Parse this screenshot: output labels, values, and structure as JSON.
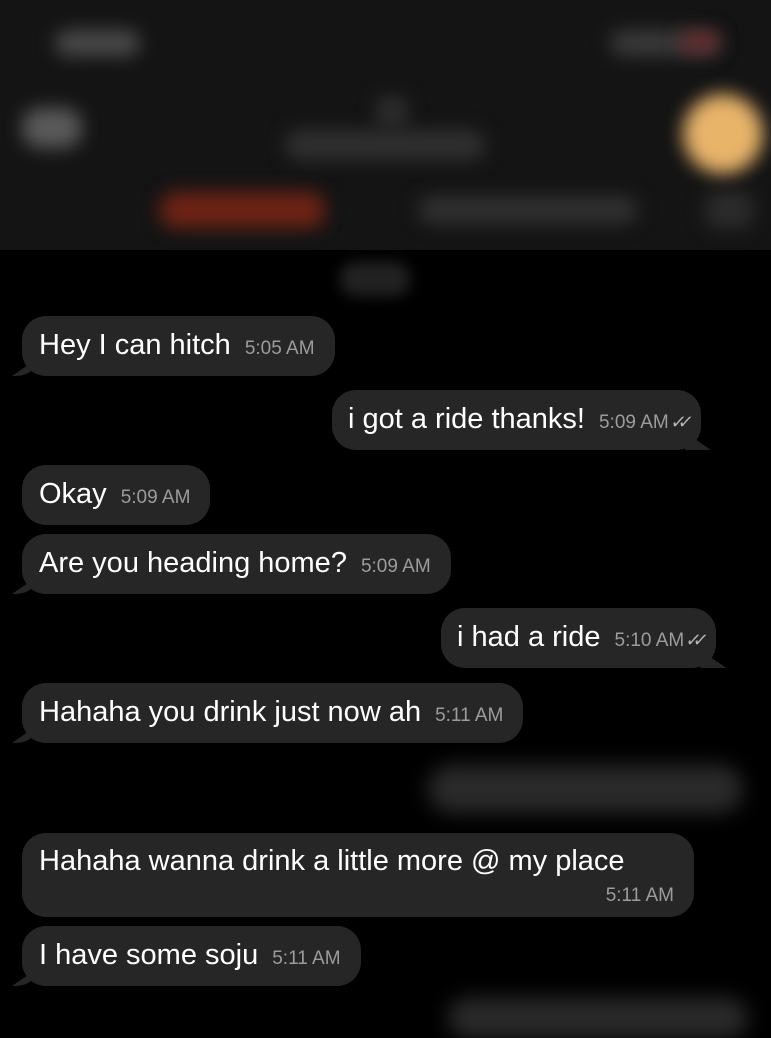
{
  "messages": [
    {
      "direction": "incoming",
      "text": "Hey I can hitch",
      "time": "5:05 AM"
    },
    {
      "direction": "outgoing",
      "text": "i got a ride thanks!",
      "time": "5:09 AM",
      "status": "read-double-check-icon"
    },
    {
      "direction": "incoming",
      "text": "Okay",
      "time": "5:09 AM"
    },
    {
      "direction": "incoming",
      "text": "Are you heading home?",
      "time": "5:09 AM"
    },
    {
      "direction": "outgoing",
      "text": "i had a ride",
      "time": "5:10 AM",
      "status": "read-double-check-icon"
    },
    {
      "direction": "incoming",
      "text": "Hahaha you drink just now ah",
      "time": "5:11 AM"
    },
    {
      "direction": "incoming",
      "text": "Hahaha wanna drink a little more @ my place",
      "time": "5:11 AM"
    },
    {
      "direction": "incoming",
      "text": "I have some soju",
      "time": "5:11 AM"
    }
  ],
  "icons": {
    "read_receipt": "double-check-icon"
  }
}
